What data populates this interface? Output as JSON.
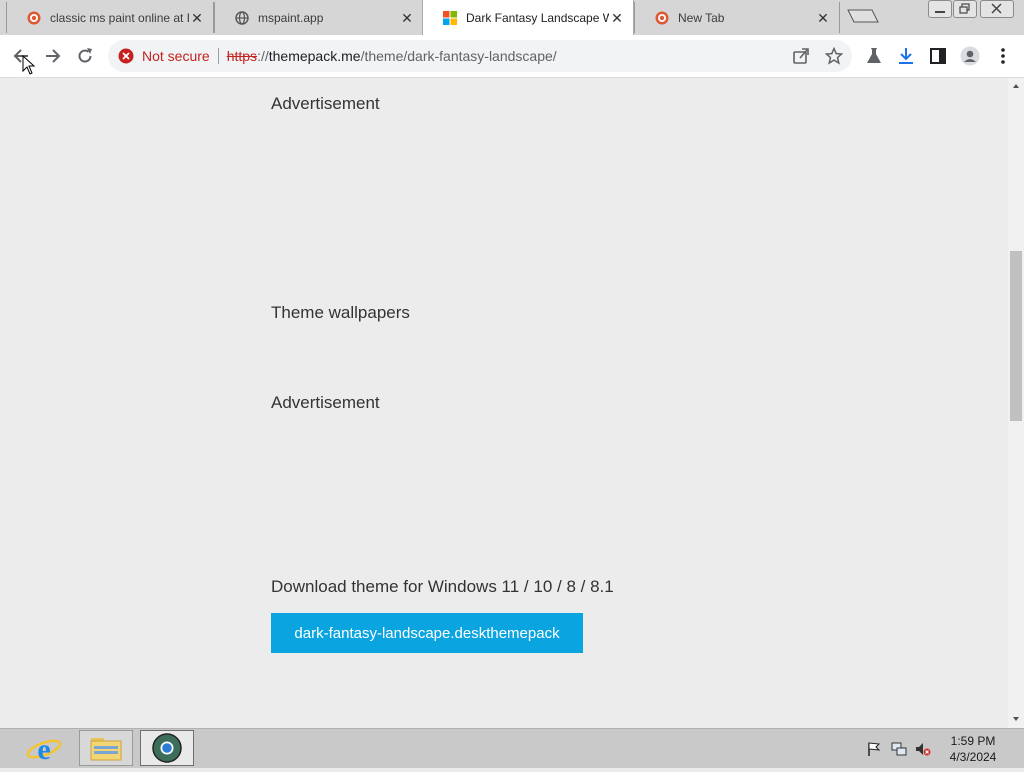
{
  "browser": {
    "tabs": [
      {
        "title": "classic ms paint online at D",
        "favicon": "duckduckgo-icon",
        "active": false
      },
      {
        "title": "mspaint.app",
        "favicon": "globe-icon",
        "active": false
      },
      {
        "title": "Dark Fantasy Landscape W",
        "favicon": "windows-logo-icon",
        "active": true
      },
      {
        "title": "New Tab",
        "favicon": "duckduckgo-icon",
        "active": false
      }
    ],
    "tab_close_glyph": "✕",
    "address": {
      "security_label": "Not secure",
      "scheme": "https",
      "scheme_separator": "://",
      "host": "themepack.me",
      "path": "/theme/dark-fantasy-landscape/"
    }
  },
  "page": {
    "ad_label_1": "Advertisement",
    "wallpapers_heading": "Theme wallpapers",
    "ad_label_2": "Advertisement",
    "download_heading": "Download theme for Windows 11 / 10 / 8 / 8.1",
    "download_button": "dark-fantasy-landscape.deskthemepack"
  },
  "taskbar": {
    "time": "1:59 PM",
    "date": "4/3/2024"
  },
  "colors": {
    "accent_button": "#0aa5e1",
    "not_secure_red": "#c5221f",
    "page_background": "#ececec"
  }
}
